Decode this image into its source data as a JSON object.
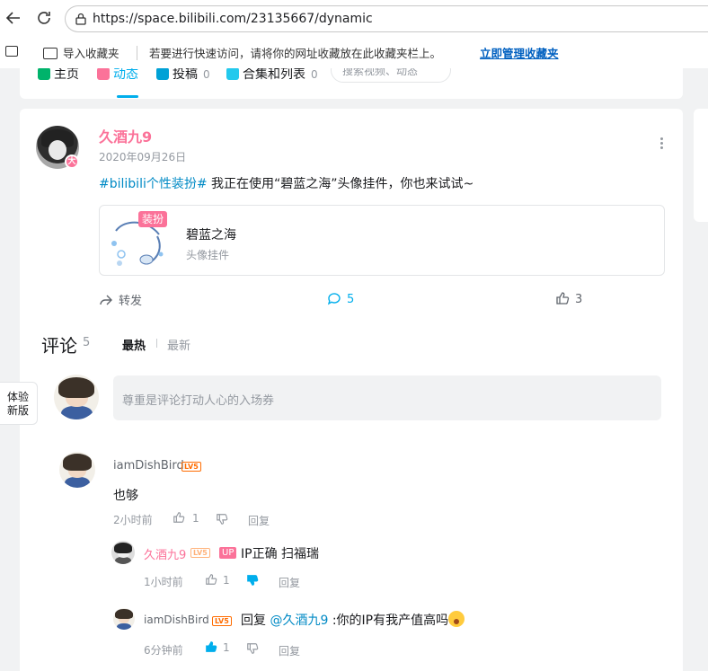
{
  "browser": {
    "url": "https://space.bilibili.com/23135667/dynamic",
    "bookmarks": {
      "import_label": "导入收藏夹",
      "tip": "若要进行快速访问，请将你的网址收藏放在此收藏夹栏上。",
      "manage_link": "立即管理收藏夹"
    }
  },
  "tabs": [
    {
      "label": "主页",
      "count": ""
    },
    {
      "label": "动态",
      "count": ""
    },
    {
      "label": "投稿",
      "count": "0"
    },
    {
      "label": "合集和列表",
      "count": "0"
    }
  ],
  "tab_search_placeholder": "搜索视频、动态",
  "post": {
    "author": "久酒九9",
    "avatar_badge": "大",
    "date": "2020年09月26日",
    "tag": "#bilibili个性装扮#",
    "text": " 我正在使用“碧蓝之海”头像挂件，你也来试试~",
    "item": {
      "label": "装扮",
      "title": "碧蓝之海",
      "subtitle": "头像挂件"
    },
    "actions": {
      "forward": "转发",
      "comments": "5",
      "likes": "3"
    }
  },
  "comments": {
    "title": "评论",
    "count": "5",
    "sort_hot": "最热",
    "sort_new": "最新",
    "input_placeholder": "尊重是评论打动人心的入场券",
    "items": [
      {
        "user": "iamDishBird",
        "level": "LV5",
        "text": "也够",
        "time": "2小时前",
        "likes": "1",
        "reply": "回复",
        "replies": [
          {
            "user": "久酒九9",
            "level": "LV5",
            "up_tag": "UP",
            "text": "IP正确 扫福瑞",
            "time": "1小时前",
            "likes": "1",
            "reply": "回复"
          },
          {
            "user": "iamDishBird",
            "level": "LV5",
            "prefix": "回复 ",
            "mention": "@久酒九9",
            "text": " :你的IP有我产值高吗",
            "time": "6分钟前",
            "likes": "1",
            "reply": "回复"
          }
        ]
      }
    ]
  },
  "float_tab": "体验新版",
  "colors": {
    "accent": "#00aeec",
    "pink": "#fb7299",
    "level": "#ff6c00",
    "link": "#008ac5"
  }
}
